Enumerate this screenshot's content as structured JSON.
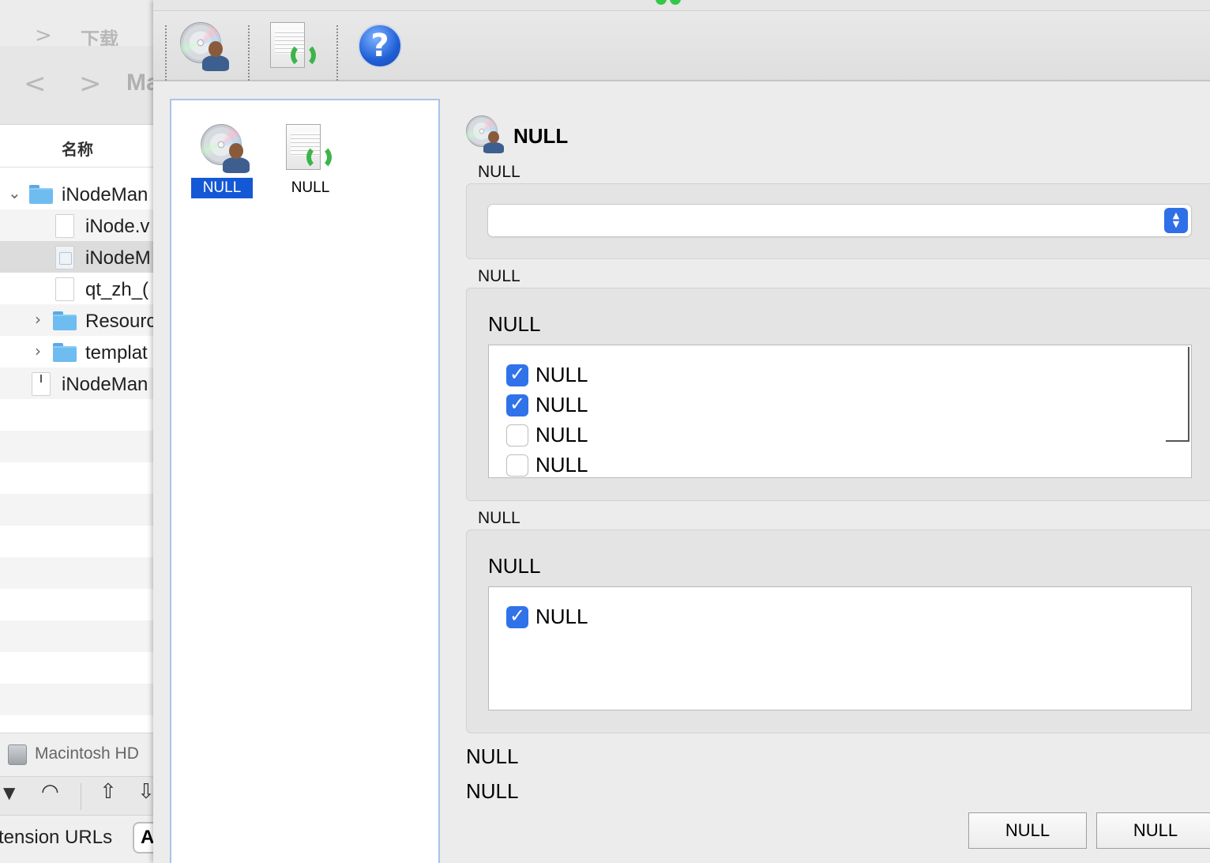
{
  "finder": {
    "path_label": "下载",
    "toolbar_partial_title": "Ma",
    "column_header": "名称",
    "rows": [
      {
        "label": "iNodeMan",
        "kind": "folder",
        "expanded": true
      },
      {
        "label": "iNode.v",
        "kind": "file"
      },
      {
        "label": "iNodeM",
        "kind": "image-file",
        "selected": true
      },
      {
        "label": "qt_zh_(",
        "kind": "file"
      },
      {
        "label": "Resourc",
        "kind": "folder"
      },
      {
        "label": "templat",
        "kind": "folder"
      },
      {
        "label": "iNodeMan",
        "kind": "executable"
      }
    ],
    "drive_label": "Macintosh HD",
    "bottom_text": "tension URLs",
    "bottom_button_partial": "A"
  },
  "app": {
    "toolbar": [
      {
        "name": "disc-user-tool",
        "icon": "disc-user-icon"
      },
      {
        "name": "document-refresh-tool",
        "icon": "document-refresh-icon"
      },
      {
        "name": "help-tool",
        "icon": "help-icon",
        "glyph": "?"
      }
    ],
    "list": [
      {
        "label": "NULL",
        "icon": "disc-user-icon",
        "selected": true
      },
      {
        "label": "NULL",
        "icon": "document-refresh-icon",
        "selected": false
      }
    ],
    "heading": "NULL",
    "section1": {
      "label": "NULL",
      "combo_value": ""
    },
    "section2": {
      "label": "NULL",
      "inner_title": "NULL",
      "items": [
        {
          "label": "NULL",
          "checked": true
        },
        {
          "label": "NULL",
          "checked": true
        },
        {
          "label": "NULL",
          "checked": false
        },
        {
          "label": "NULL",
          "checked": false
        }
      ]
    },
    "section3": {
      "label": "NULL",
      "inner_title": "NULL",
      "items": [
        {
          "label": "NULL",
          "checked": true
        }
      ]
    },
    "text1": "NULL",
    "text2": "NULL",
    "buttons": {
      "ok": "NULL",
      "cancel": "NULL"
    },
    "colors": {
      "accent": "#2f72ea",
      "selection": "#1558d6"
    }
  }
}
